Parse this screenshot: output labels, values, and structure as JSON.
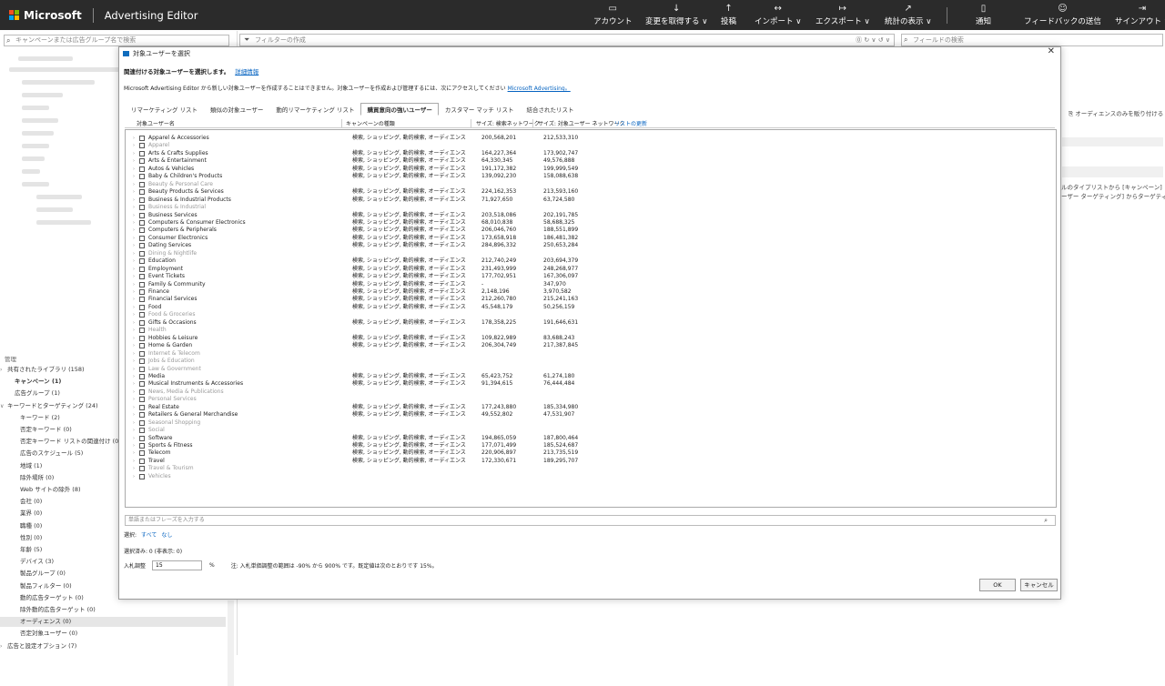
{
  "topbar": {
    "brand": "Microsoft",
    "app": "Advertising Editor",
    "items": [
      {
        "label": "アカウント",
        "icon": "▭"
      },
      {
        "label": "変更を取得する ∨",
        "icon": "↓"
      },
      {
        "label": "投稿",
        "icon": "↑"
      },
      {
        "label": "インポート ∨",
        "icon": "↔"
      },
      {
        "label": "エクスポート ∨",
        "icon": "↦"
      },
      {
        "label": "統計の表示 ∨",
        "icon": "↗"
      },
      {
        "label": "通知",
        "icon": "▯"
      },
      {
        "label": "フィードバックの送信",
        "icon": "☺"
      },
      {
        "label": "サインアウト ∨",
        "icon": "⇥"
      }
    ]
  },
  "leftpane": {
    "search_placeholder": "キャンペーンまたは広告グループ名で検索",
    "tree_header": "管理",
    "tree": [
      {
        "label": "共有されたライブラリ (158)",
        "toggle": "›",
        "bold": false
      },
      {
        "label": "キャンペーン (1)",
        "toggle": "",
        "bold": true
      },
      {
        "label": "広告グループ (1)",
        "toggle": "",
        "bold": false
      },
      {
        "label": "キーワードとターゲティング (24)",
        "toggle": "∨",
        "bold": false
      },
      {
        "label": "キーワード (2)",
        "toggle": "",
        "bold": false
      },
      {
        "label": "否定キーワード (0)",
        "toggle": "",
        "bold": false
      },
      {
        "label": "否定キーワード リストの関連付け (0)",
        "toggle": "",
        "bold": false
      },
      {
        "label": "広告のスケジュール (5)",
        "toggle": "",
        "bold": false
      },
      {
        "label": "地域 (1)",
        "toggle": "",
        "bold": false
      },
      {
        "label": "除外場所 (0)",
        "toggle": "",
        "bold": false
      },
      {
        "label": "Web サイトの除外 (8)",
        "toggle": "",
        "bold": false
      },
      {
        "label": "会社 (0)",
        "toggle": "",
        "bold": false
      },
      {
        "label": "業界 (0)",
        "toggle": "",
        "bold": false
      },
      {
        "label": "職種 (0)",
        "toggle": "",
        "bold": false
      },
      {
        "label": "性別 (0)",
        "toggle": "",
        "bold": false
      },
      {
        "label": "年齢 (5)",
        "toggle": "",
        "bold": false
      },
      {
        "label": "デバイス (3)",
        "toggle": "",
        "bold": false
      },
      {
        "label": "製品グループ (0)",
        "toggle": "",
        "bold": false
      },
      {
        "label": "製品フィルター (0)",
        "toggle": "",
        "bold": false
      },
      {
        "label": "動的広告ターゲット (0)",
        "toggle": "",
        "bold": false
      },
      {
        "label": "除外動的広告ターゲット (0)",
        "toggle": "",
        "bold": false
      },
      {
        "label": "オーディエンス (0)",
        "toggle": "",
        "bold": false
      },
      {
        "label": "否定対象ユーザー (0)",
        "toggle": "",
        "bold": false
      },
      {
        "label": "広告と設定オプション (7)",
        "toggle": "›",
        "bold": false
      }
    ]
  },
  "midpane": {
    "filter_placeholder": "フィルターの作成",
    "filter_icons": "⓪ ↻ ∨ ↺ ∨"
  },
  "rightpane": {
    "search_placeholder": "フィールドの検索",
    "text1": "オーディエンスのみを販り付ける",
    "text2": "ルのタイプリストから [キャンペーン]",
    "text3": "ーザー ターゲティング] からターゲティ"
  },
  "dialog": {
    "title": "対象ユーザーを選択",
    "heading": "関連付ける対象ユーザーを選択します。",
    "heading_link": "詳細情報",
    "info": "Microsoft Advertising Editor から新しい対象ユーザーを作成することはできません。対象ユーザーを作成および管理するには、次にアクセスしてください",
    "info_link": "Microsoft Advertising。",
    "tabs": [
      "リマーケティング リスト",
      "類似の対象ユーザー",
      "動的リマーケティング リスト",
      "購買意向の強いユーザー",
      "カスタマー マッチ リスト",
      "結合されたリスト"
    ],
    "active_tab": 3,
    "columns": {
      "name": "対象ユーザー名",
      "type": "キャンペーンの種類",
      "search": "サイズ: 検索ネットワーク",
      "audience": "サイズ: 対象ユーザー ネットワーク",
      "update": "リストの更新"
    },
    "rows": [
      {
        "name": "Apparel & Accessories",
        "type": "検索, ショッピング, 動的検索, オーディエンス",
        "search": "200,568,201",
        "audience": "212,533,310",
        "gray": false
      },
      {
        "name": "Apparel",
        "type": "",
        "search": "",
        "audience": "",
        "gray": true
      },
      {
        "name": "Arts & Crafts Supplies",
        "type": "検索, ショッピング, 動的検索, オーディエンス",
        "search": "164,227,364",
        "audience": "173,902,747",
        "gray": false
      },
      {
        "name": "Arts & Entertainment",
        "type": "検索, ショッピング, 動的検索, オーディエンス",
        "search": "64,330,345",
        "audience": "49,576,888",
        "gray": false
      },
      {
        "name": "Autos & Vehicles",
        "type": "検索, ショッピング, 動的検索, オーディエンス",
        "search": "191,172,382",
        "audience": "199,999,549",
        "gray": false
      },
      {
        "name": "Baby & Children's Products",
        "type": "検索, ショッピング, 動的検索, オーディエンス",
        "search": "139,092,230",
        "audience": "158,088,638",
        "gray": false
      },
      {
        "name": "Beauty & Personal Care",
        "type": "",
        "search": "",
        "audience": "",
        "gray": true
      },
      {
        "name": "Beauty Products & Services",
        "type": "検索, ショッピング, 動的検索, オーディエンス",
        "search": "224,162,353",
        "audience": "213,593,160",
        "gray": false
      },
      {
        "name": "Business & Industrial Products",
        "type": "検索, ショッピング, 動的検索, オーディエンス",
        "search": "71,927,650",
        "audience": "63,724,580",
        "gray": false
      },
      {
        "name": "Business & Industrial",
        "type": "",
        "search": "",
        "audience": "",
        "gray": true
      },
      {
        "name": "Business Services",
        "type": "検索, ショッピング, 動的検索, オーディエンス",
        "search": "203,518,086",
        "audience": "202,191,785",
        "gray": false
      },
      {
        "name": "Computers & Consumer Electronics",
        "type": "検索, ショッピング, 動的検索, オーディエンス",
        "search": "68,010,838",
        "audience": "58,688,325",
        "gray": false
      },
      {
        "name": "Computers & Peripherals",
        "type": "検索, ショッピング, 動的検索, オーディエンス",
        "search": "206,046,760",
        "audience": "188,551,899",
        "gray": false
      },
      {
        "name": "Consumer Electronics",
        "type": "検索, ショッピング, 動的検索, オーディエンス",
        "search": "173,658,918",
        "audience": "186,481,382",
        "gray": false
      },
      {
        "name": "Dating Services",
        "type": "検索, ショッピング, 動的検索, オーディエンス",
        "search": "284,896,332",
        "audience": "250,653,284",
        "gray": false
      },
      {
        "name": "Dining & Nightlife",
        "type": "",
        "search": "",
        "audience": "",
        "gray": true
      },
      {
        "name": "Education",
        "type": "検索, ショッピング, 動的検索, オーディエンス",
        "search": "212,740,249",
        "audience": "203,694,379",
        "gray": false
      },
      {
        "name": "Employment",
        "type": "検索, ショッピング, 動的検索, オーディエンス",
        "search": "231,493,999",
        "audience": "248,268,977",
        "gray": false
      },
      {
        "name": "Event Tickets",
        "type": "検索, ショッピング, 動的検索, オーディエンス",
        "search": "177,702,951",
        "audience": "167,306,097",
        "gray": false
      },
      {
        "name": "Family & Community",
        "type": "検索, ショッピング, 動的検索, オーディエンス",
        "search": "-",
        "audience": "347,970",
        "gray": false
      },
      {
        "name": "Finance",
        "type": "検索, ショッピング, 動的検索, オーディエンス",
        "search": "2,148,196",
        "audience": "3,970,582",
        "gray": false
      },
      {
        "name": "Financial Services",
        "type": "検索, ショッピング, 動的検索, オーディエンス",
        "search": "212,260,780",
        "audience": "215,241,163",
        "gray": false
      },
      {
        "name": "Food",
        "type": "検索, ショッピング, 動的検索, オーディエンス",
        "search": "45,548,179",
        "audience": "50,256,159",
        "gray": false
      },
      {
        "name": "Food & Groceries",
        "type": "",
        "search": "",
        "audience": "",
        "gray": true
      },
      {
        "name": "Gifts & Occasions",
        "type": "検索, ショッピング, 動的検索, オーディエンス",
        "search": "178,358,225",
        "audience": "191,646,631",
        "gray": false
      },
      {
        "name": "Health",
        "type": "",
        "search": "",
        "audience": "",
        "gray": true
      },
      {
        "name": "Hobbies & Leisure",
        "type": "検索, ショッピング, 動的検索, オーディエンス",
        "search": "109,822,989",
        "audience": "83,688,243",
        "gray": false
      },
      {
        "name": "Home & Garden",
        "type": "検索, ショッピング, 動的検索, オーディエンス",
        "search": "206,304,749",
        "audience": "217,387,845",
        "gray": false
      },
      {
        "name": "Internet & Telecom",
        "type": "",
        "search": "",
        "audience": "",
        "gray": true
      },
      {
        "name": "Jobs & Education",
        "type": "",
        "search": "",
        "audience": "",
        "gray": true
      },
      {
        "name": "Law & Government",
        "type": "",
        "search": "",
        "audience": "",
        "gray": true
      },
      {
        "name": "Media",
        "type": "検索, ショッピング, 動的検索, オーディエンス",
        "search": "65,423,752",
        "audience": "61,274,180",
        "gray": false
      },
      {
        "name": "Musical Instruments & Accessories",
        "type": "検索, ショッピング, 動的検索, オーディエンス",
        "search": "91,394,615",
        "audience": "76,444,484",
        "gray": false
      },
      {
        "name": "News, Media & Publications",
        "type": "",
        "search": "",
        "audience": "",
        "gray": true
      },
      {
        "name": "Personal Services",
        "type": "",
        "search": "",
        "audience": "",
        "gray": true
      },
      {
        "name": "Real Estate",
        "type": "検索, ショッピング, 動的検索, オーディエンス",
        "search": "177,243,880",
        "audience": "185,334,980",
        "gray": false
      },
      {
        "name": "Retailers & General Merchandise",
        "type": "検索, ショッピング, 動的検索, オーディエンス",
        "search": "49,552,802",
        "audience": "47,531,907",
        "gray": false
      },
      {
        "name": "Seasonal Shopping",
        "type": "",
        "search": "",
        "audience": "",
        "gray": true
      },
      {
        "name": "Social",
        "type": "",
        "search": "",
        "audience": "",
        "gray": true
      },
      {
        "name": "Software",
        "type": "検索, ショッピング, 動的検索, オーディエンス",
        "search": "194,865,059",
        "audience": "187,800,464",
        "gray": false
      },
      {
        "name": "Sports & Fitness",
        "type": "検索, ショッピング, 動的検索, オーディエンス",
        "search": "177,071,499",
        "audience": "185,524,687",
        "gray": false
      },
      {
        "name": "Telecom",
        "type": "検索, ショッピング, 動的検索, オーディエンス",
        "search": "220,906,897",
        "audience": "213,735,519",
        "gray": false
      },
      {
        "name": "Travel",
        "type": "検索, ショッピング, 動的検索, オーディエンス",
        "search": "172,330,671",
        "audience": "189,295,707",
        "gray": false
      },
      {
        "name": "Travel & Tourism",
        "type": "",
        "search": "",
        "audience": "",
        "gray": true
      },
      {
        "name": "Vehicles",
        "type": "",
        "search": "",
        "audience": "",
        "gray": true
      }
    ],
    "filter_placeholder": "単語またはフレーズを入力する",
    "select_label": "選択:",
    "select_all": "すべて",
    "select_none": "なし",
    "selected_count": "選択済み: 0 (非表示: 0)",
    "bid_label": "入札調整",
    "bid_value": "15",
    "bid_unit": "%",
    "bid_note": "注: 入札単価調整の範囲は -90% から 900% です。既定値は次のとおりです 15%。",
    "ok": "OK",
    "cancel": "キャンセル"
  }
}
